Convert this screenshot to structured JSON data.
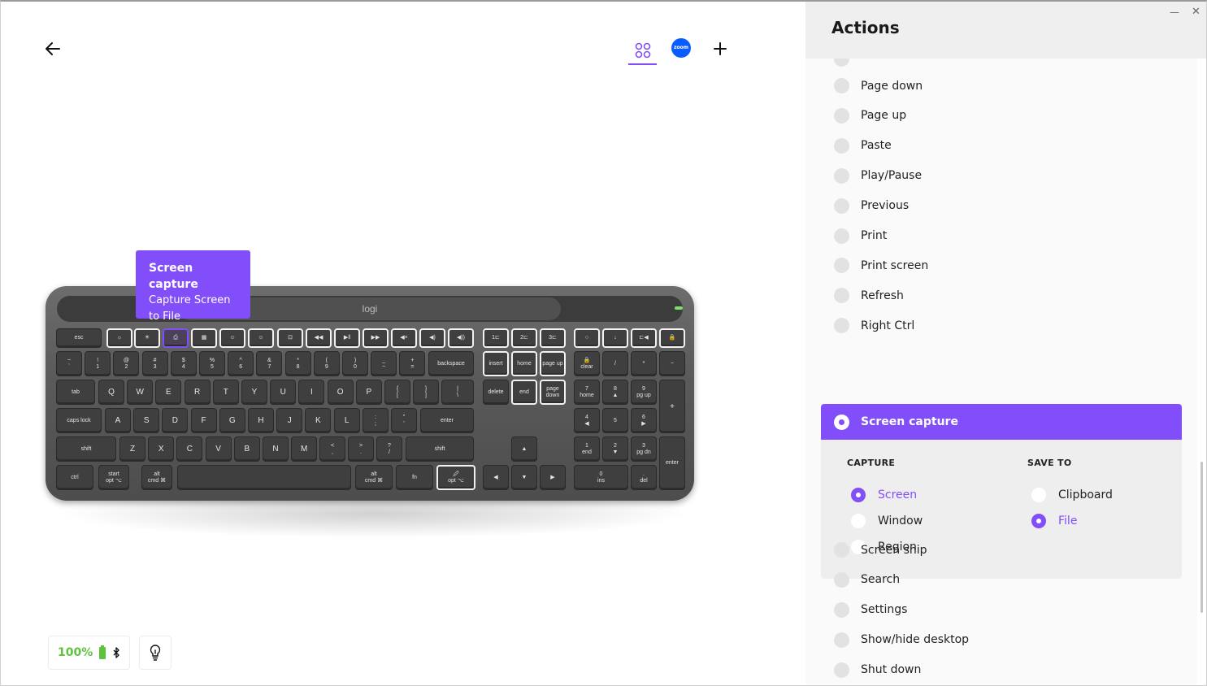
{
  "toolbar": {
    "zoom_label": "zoom"
  },
  "keyboard": {
    "logo": "logi",
    "row_fn": [
      "esc",
      "☼",
      "☀",
      "⎙",
      "▦",
      "☺",
      "☺",
      "⊡",
      "◀◀",
      "▶‖",
      "▶▶",
      "◀×",
      "◀)",
      "◀))",
      "1⊏",
      "2⊏",
      "3⊏",
      "○",
      "↓",
      "⊏◀",
      "🔒"
    ],
    "row_num": [
      [
        "~",
        "`"
      ],
      [
        "!",
        "1"
      ],
      [
        "@",
        "2"
      ],
      [
        "#",
        "3"
      ],
      [
        "$",
        "4"
      ],
      [
        "%",
        "5"
      ],
      [
        "^",
        "6"
      ],
      [
        "&",
        "7"
      ],
      [
        "*",
        "8"
      ],
      [
        "(",
        "9"
      ],
      [
        ")",
        "0"
      ],
      [
        "_",
        "−"
      ],
      [
        "+",
        "="
      ]
    ],
    "row_q": [
      "Q",
      "W",
      "E",
      "R",
      "T",
      "Y",
      "U",
      "I",
      "O",
      "P"
    ],
    "row_a": [
      "A",
      "S",
      "D",
      "F",
      "G",
      "H",
      "J",
      "K",
      "L"
    ],
    "row_z": [
      "Z",
      "X",
      "C",
      "V",
      "B",
      "N",
      "M"
    ],
    "labels": {
      "backspace": "backspace",
      "tab": "tab",
      "caps": "caps lock",
      "enter": "enter",
      "shift_l": "shift",
      "shift_r": "shift",
      "ctrl": "ctrl",
      "start_top": "start",
      "start_bottom": "opt ⌥",
      "alt_top": "alt",
      "alt_bottom": "cmd ⌘",
      "alt2_top": "alt",
      "alt2_bottom": "cmd ⌘",
      "fn": "fn",
      "opt_bottom": "opt ⌥",
      "insert": "insert",
      "home": "home",
      "pageup": "page up",
      "delete": "delete",
      "end": "end",
      "pagedown": "page down",
      "clear": "clear",
      "slash": "/",
      "star": "*",
      "minus": "−",
      "plus": "+",
      "numenter": "enter",
      "n7": [
        "7",
        "home"
      ],
      "n8": [
        "8",
        "▲"
      ],
      "n9": [
        "9",
        "pg up"
      ],
      "n4": [
        "4",
        "◀"
      ],
      "n5": [
        "5",
        ""
      ],
      "n6": [
        "6",
        "▶"
      ],
      "n1": [
        "1",
        "end"
      ],
      "n2": [
        "2",
        "▼"
      ],
      "n3": [
        "3",
        "pg dn"
      ],
      "n0": [
        "0",
        "ins"
      ],
      "ndot": [
        ".",
        "del"
      ],
      "bracket_l": [
        "{",
        "["
      ],
      "bracket_r": [
        "}",
        "]"
      ],
      "pipe": [
        "|",
        "\\"
      ],
      "semicolon": [
        ":",
        ";"
      ],
      "quote": [
        "\"",
        "'"
      ],
      "comma": [
        "<",
        ","
      ],
      "period": [
        ">",
        "."
      ],
      "question": [
        "?",
        "/"
      ]
    }
  },
  "tooltip": {
    "title": "Screen capture",
    "line1": "Capture Screen",
    "line2": "to File"
  },
  "status": {
    "battery": "100%"
  },
  "panel": {
    "title": "Actions",
    "items": [
      "Page down",
      "Page up",
      "Paste",
      "Play/Pause",
      "Previous",
      "Print",
      "Print screen",
      "Refresh",
      "Right Ctrl"
    ],
    "selected": "Screen capture",
    "capture_heading": "CAPTURE",
    "save_heading": "SAVE TO",
    "capture_options": [
      "Screen",
      "Window",
      "Region"
    ],
    "save_options": [
      "Clipboard",
      "File"
    ],
    "items_after": [
      "Screen snip",
      "Search",
      "Settings",
      "Show/hide desktop",
      "Shut down"
    ]
  },
  "colors": {
    "accent": "#814EFA",
    "battery": "#5DC23E",
    "zoom": "#0B5CFF"
  }
}
